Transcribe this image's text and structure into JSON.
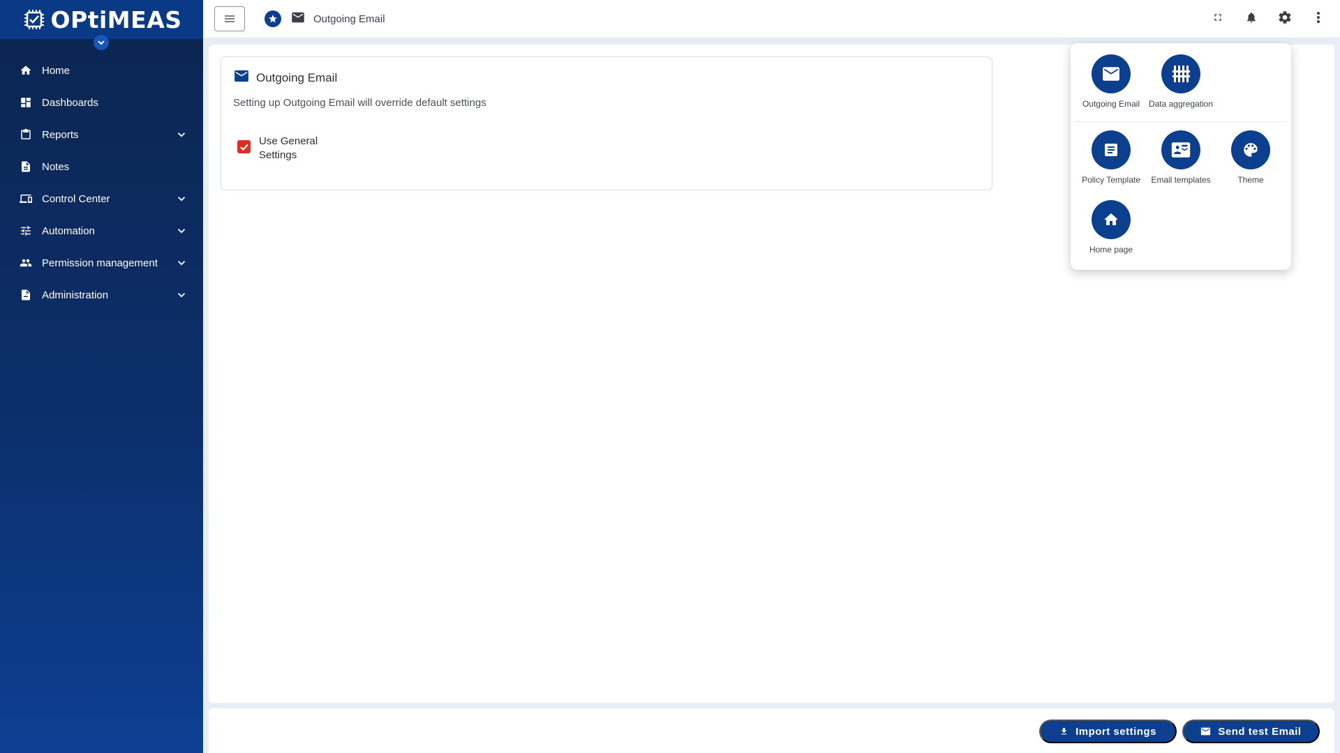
{
  "brand": {
    "logo_text": "OPtiMEAS"
  },
  "sidebar": {
    "items": [
      {
        "label": "Home",
        "icon": "home-icon",
        "expandable": false
      },
      {
        "label": "Dashboards",
        "icon": "dashboard-icon",
        "expandable": false
      },
      {
        "label": "Reports",
        "icon": "clipboard-icon",
        "expandable": true
      },
      {
        "label": "Notes",
        "icon": "document-icon",
        "expandable": false
      },
      {
        "label": "Control Center",
        "icon": "devices-icon",
        "expandable": true
      },
      {
        "label": "Automation",
        "icon": "sliders-icon",
        "expandable": true
      },
      {
        "label": "Permission management",
        "icon": "people-icon",
        "expandable": true
      },
      {
        "label": "Administration",
        "icon": "admin-document-icon",
        "expandable": true
      }
    ]
  },
  "topbar": {
    "breadcrumb_title": "Outgoing Email",
    "icons": [
      "fullscreen-icon",
      "bell-icon",
      "gear-icon",
      "more-vert-icon"
    ]
  },
  "settings_card": {
    "title": "Outgoing Email",
    "description": "Setting up Outgoing Email will override default settings",
    "checkbox_label": "Use General Settings",
    "checkbox_checked": true
  },
  "bottom_bar": {
    "import_label": "Import settings",
    "send_test_label": "Send test Email"
  },
  "popover": {
    "items": [
      {
        "label": "Outgoing Email",
        "icon": "mail-icon"
      },
      {
        "label": "Data aggregation",
        "icon": "aggregation-icon"
      },
      {
        "label": "Policy Template",
        "icon": "policy-icon"
      },
      {
        "label": "Email templates",
        "icon": "contact-mail-icon"
      },
      {
        "label": "Theme",
        "icon": "palette-icon"
      },
      {
        "label": "Home page",
        "icon": "home-icon"
      }
    ]
  },
  "colors": {
    "primary": "#0d3f8f",
    "sidebar_dark": "#0b2550",
    "check": "#d93025"
  }
}
